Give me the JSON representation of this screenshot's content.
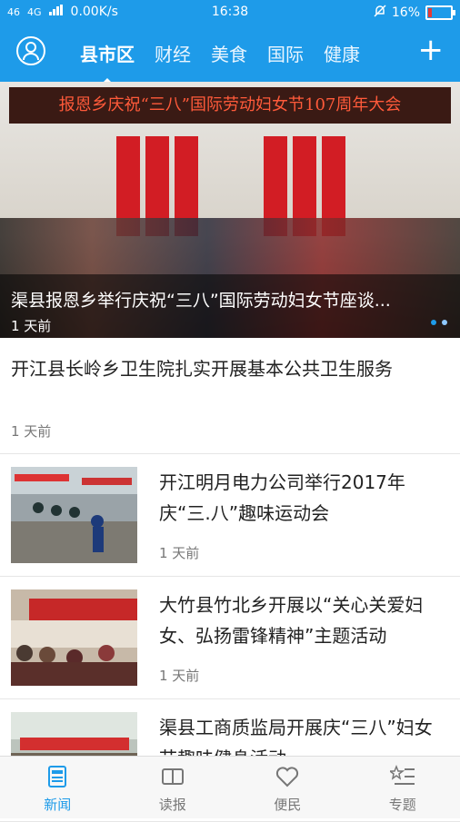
{
  "status_bar": {
    "network": "46",
    "signal_label": "4G",
    "speed": "0.00K/s",
    "time": "16:38",
    "battery": "16%",
    "battery_level": 0.16
  },
  "nav": {
    "tabs": [
      {
        "label": "县市区",
        "active": true
      },
      {
        "label": "财经",
        "active": false
      },
      {
        "label": "美食",
        "active": false
      },
      {
        "label": "国际",
        "active": false
      },
      {
        "label": "健康",
        "active": false
      }
    ],
    "plus_label": "+"
  },
  "hero": {
    "sign_text": "报恩乡庆祝“三八”国际劳动妇女节107周年大会",
    "title": "渠县报恩乡举行庆祝“三八”国际劳动妇女节座谈...",
    "time": "1 天前"
  },
  "news": [
    {
      "title": "开江县长岭乡卫生院扎实开展基本公共卫生服务",
      "time": "1 天前"
    },
    {
      "title": "开江明月电力公司举行2017年庆“三.八”趣味运动会",
      "time": "1 天前"
    },
    {
      "title": "大竹县竹北乡开展以“关心关爱妇女、弘扬雷锋精神”主题活动",
      "time": "1 天前"
    },
    {
      "title": "渠县工商质监局开展庆“三八”妇女节趣味健身活动",
      "time": ""
    }
  ],
  "bottom_nav": [
    {
      "label": "新闻",
      "icon": "newspaper-icon",
      "active": true
    },
    {
      "label": "读报",
      "icon": "reader-icon",
      "active": false
    },
    {
      "label": "便民",
      "icon": "heart-icon",
      "active": false
    },
    {
      "label": "专题",
      "icon": "topics-icon",
      "active": false
    }
  ],
  "colors": {
    "accent": "#1e9be9",
    "battery_low": "#e53935"
  }
}
